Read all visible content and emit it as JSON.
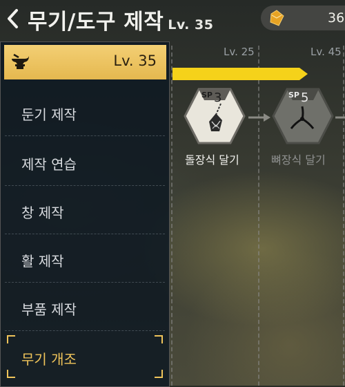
{
  "header": {
    "title": "무기/도구 제작",
    "level": "Lv. 35",
    "currency_value": "36",
    "back_icon": "chevron-left-icon",
    "currency_icon": "gem-icon"
  },
  "panel": {
    "level_label": "Lv. 35",
    "icon": "anvil-icon",
    "items": [
      {
        "label": "둔기 제작"
      },
      {
        "label": "제작 연습"
      },
      {
        "label": "창 제작"
      },
      {
        "label": "활 제작"
      },
      {
        "label": "부품 제작"
      },
      {
        "label": "무기 개조"
      }
    ],
    "selected_index": 5
  },
  "tree": {
    "columns": [
      {
        "level": "Lv. 25"
      },
      {
        "level": "Lv. 45"
      }
    ],
    "skills": [
      {
        "name": "돌장식 달기",
        "sp_label": "SP",
        "sp_value": "3",
        "icon": "stone-pendant-icon",
        "unlocked": true
      },
      {
        "name": "뼈장식 달기",
        "sp_label": "SP",
        "sp_value": "5",
        "icon": "bone-ornament-icon",
        "unlocked": false
      }
    ]
  },
  "colors": {
    "accent_gold": "#f0c45a",
    "progress_yellow": "#f5d21a",
    "panel_bg": "#0e1822"
  }
}
